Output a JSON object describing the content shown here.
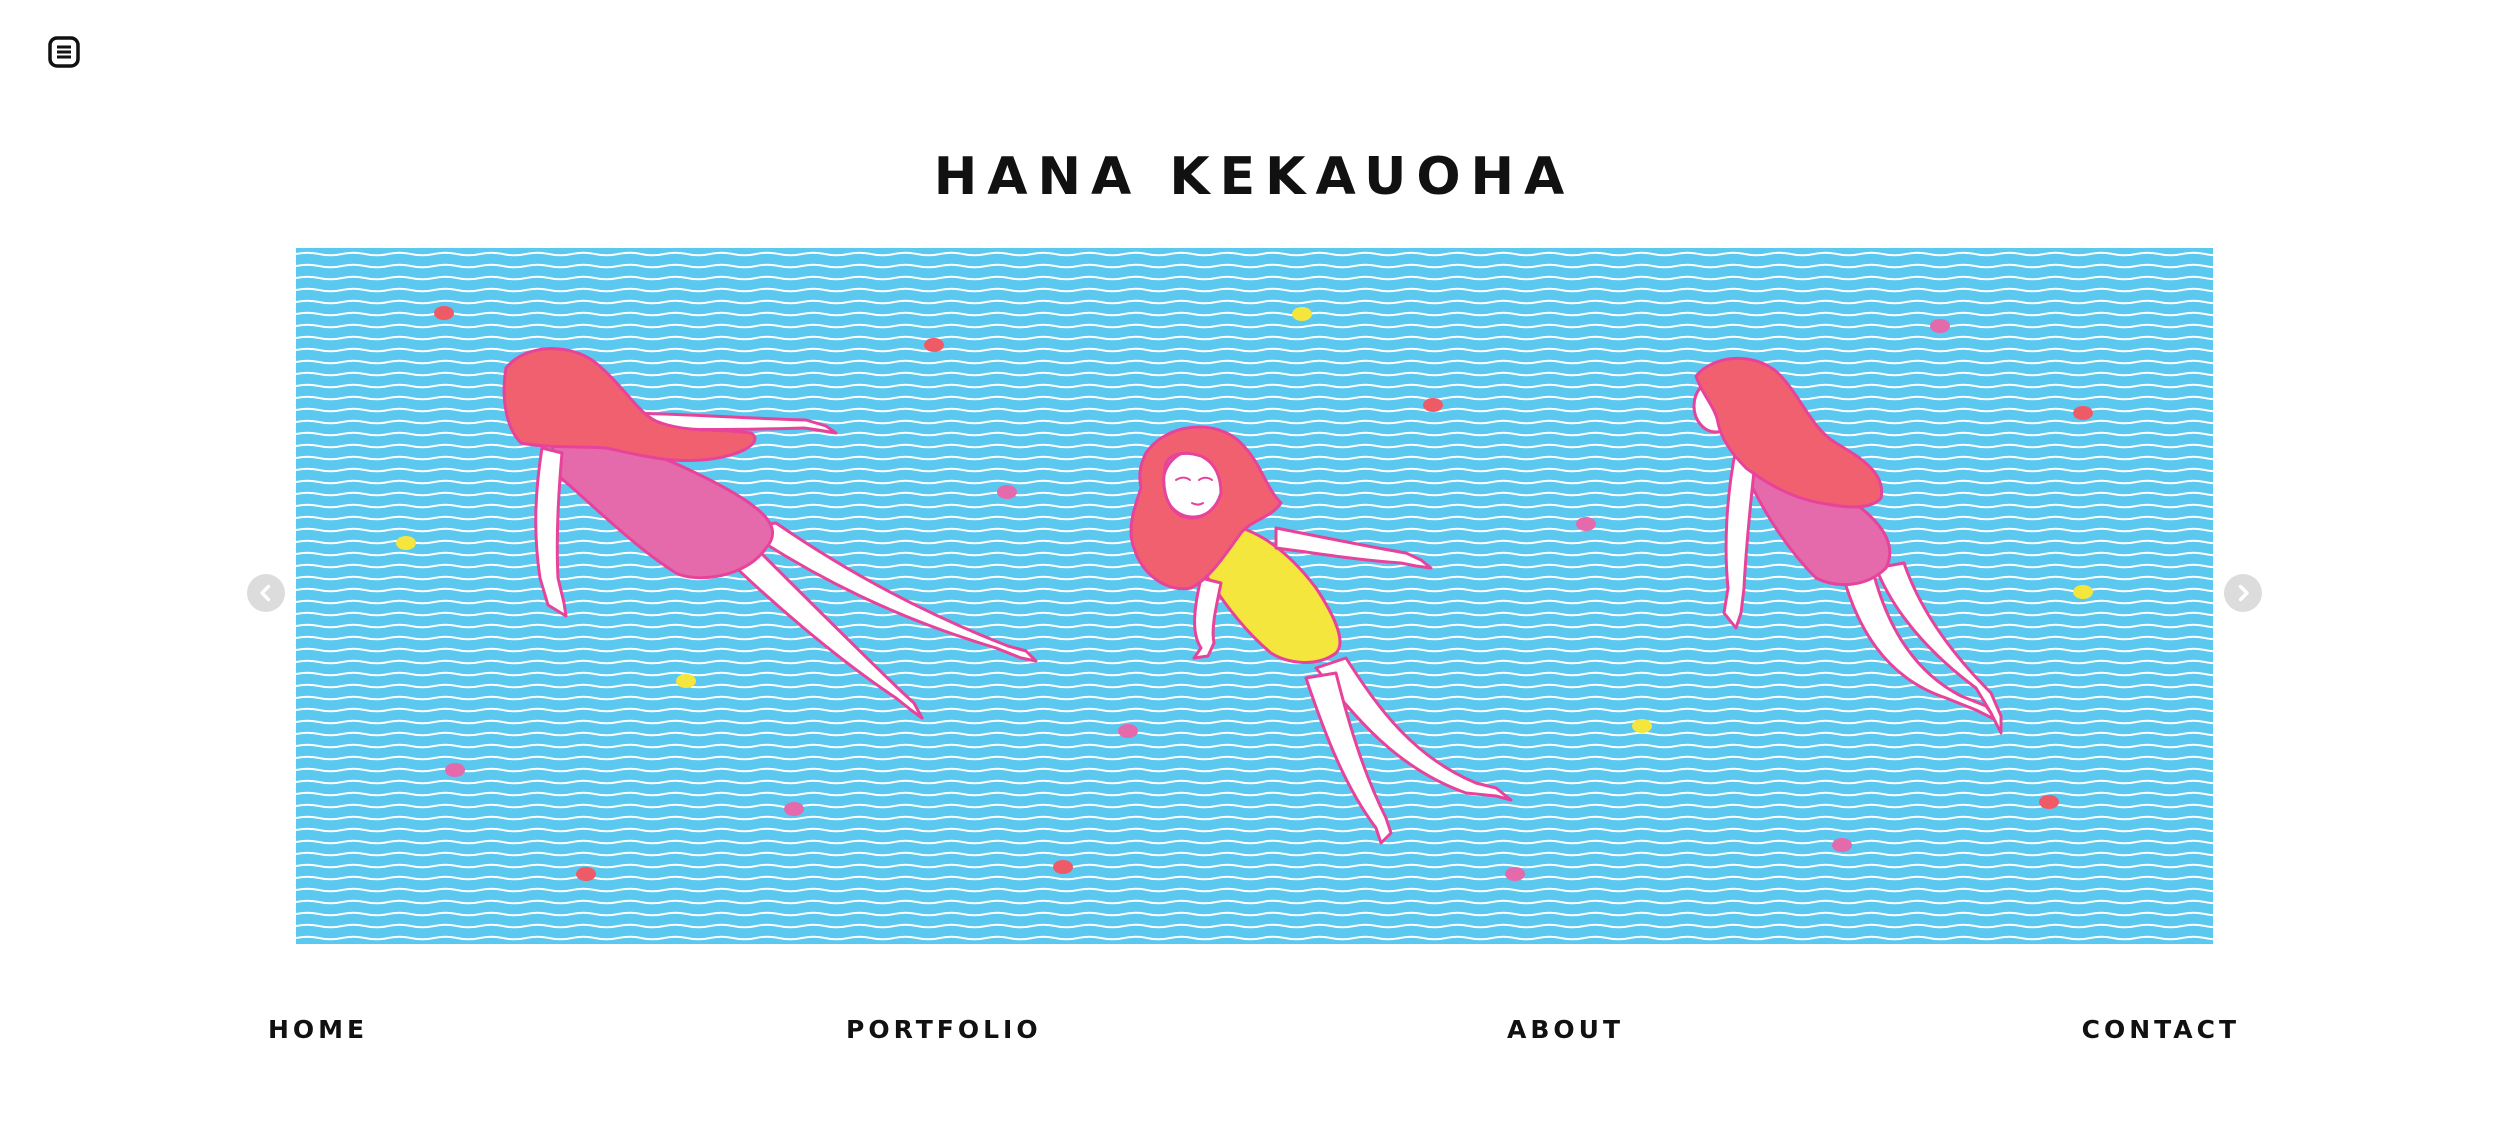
{
  "header": {
    "menu_icon": "menu-icon",
    "site_title": "HANA KEKAUOHA"
  },
  "slider": {
    "image_description_icon": "illustration",
    "prev_icon": "chevron-left-icon",
    "next_icon": "chevron-right-icon",
    "colors": {
      "water": "#5bc8ef",
      "waves": "#ffffff",
      "hair": "#f0606e",
      "pink_swimsuit": "#e46aab",
      "yellow_swimsuit": "#f5e63e",
      "skin": "#ffffff",
      "outline": "#e8439b",
      "dot_red": "#ef5a67",
      "dot_pink": "#e46aab",
      "dot_yellow": "#f5e63e"
    }
  },
  "nav": {
    "items": [
      {
        "label": "HOME"
      },
      {
        "label": "PORTFOLIO"
      },
      {
        "label": "ABOUT"
      },
      {
        "label": "CONTACT"
      }
    ]
  }
}
